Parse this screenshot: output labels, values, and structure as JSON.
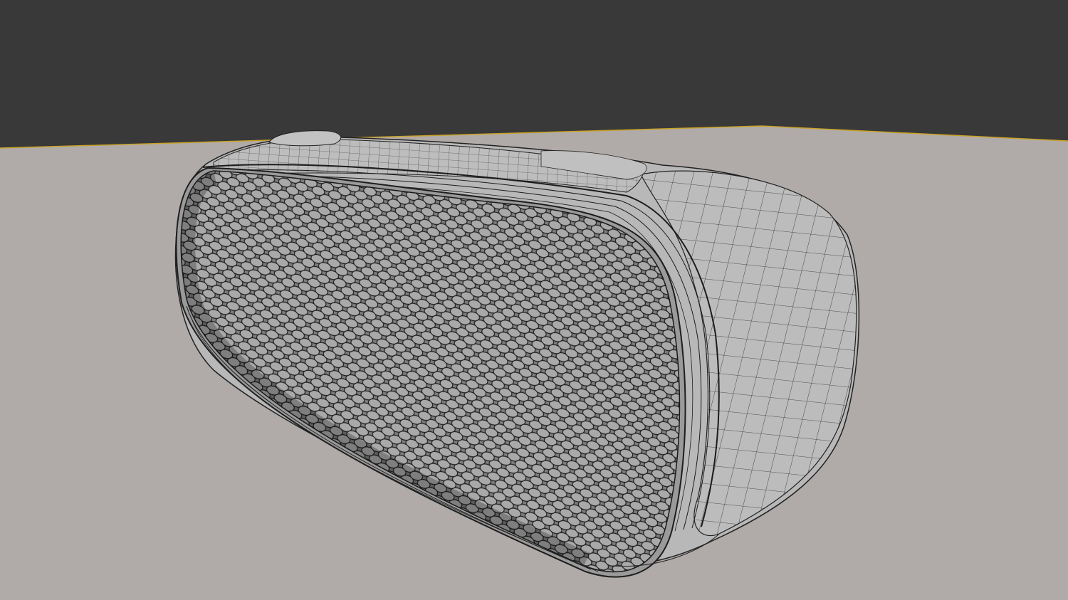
{
  "viewport": {
    "background_color": "#393939",
    "ground_color": "#b0aba8",
    "ground_edge_color": "#c9a227",
    "mesh_face_color": "#b8b8b8",
    "mesh_wire_color": "#2a2a2a",
    "grille_hole_color": "#a9a9a9",
    "object": "portable-speaker-wireframe-mesh"
  }
}
